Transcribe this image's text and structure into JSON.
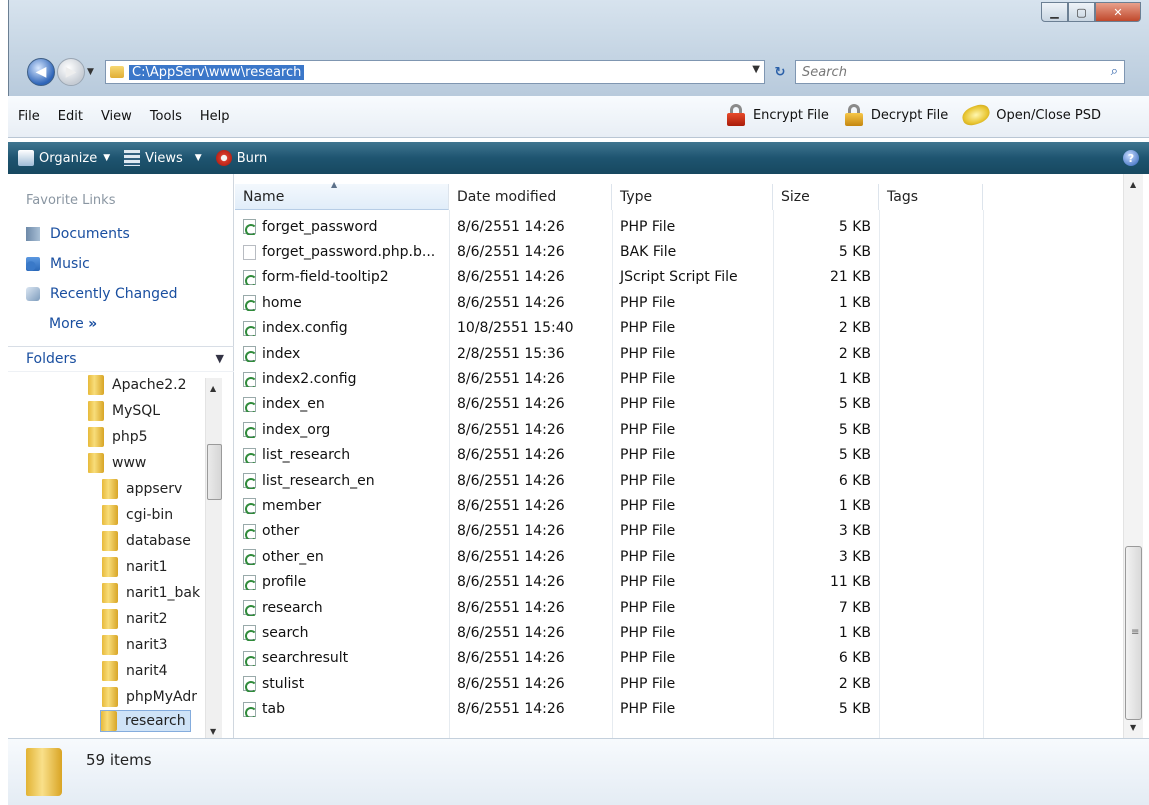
{
  "address": {
    "path": "C:\\AppServ\\www\\research"
  },
  "search": {
    "placeholder": "Search"
  },
  "menu": [
    "File",
    "Edit",
    "View",
    "Tools",
    "Help"
  ],
  "menu_right": {
    "encrypt": "Encrypt File",
    "decrypt": "Decrypt File",
    "psd": "Open/Close PSD"
  },
  "toolbar": {
    "organize": "Organize",
    "views": "Views",
    "burn": "Burn"
  },
  "favorites": {
    "title": "Favorite Links",
    "items": [
      "Documents",
      "Music",
      "Recently Changed"
    ],
    "more": "More"
  },
  "folders": {
    "title": "Folders",
    "tree": [
      "Apache2.2",
      "MySQL",
      "php5",
      "www",
      "appserv",
      "cgi-bin",
      "database",
      "narit1",
      "narit1_bak",
      "narit2",
      "narit3",
      "narit4",
      "phpMyAdr",
      "research"
    ]
  },
  "columns": {
    "name": "Name",
    "date": "Date modified",
    "type": "Type",
    "size": "Size",
    "tags": "Tags"
  },
  "files": [
    {
      "name": "forget_password",
      "date": "8/6/2551 14:26",
      "type": "PHP File",
      "size": "5 KB",
      "icon": "php"
    },
    {
      "name": "forget_password.php.b...",
      "date": "8/6/2551 14:26",
      "type": "BAK File",
      "size": "5 KB",
      "icon": "bak"
    },
    {
      "name": "form-field-tooltip2",
      "date": "8/6/2551 14:26",
      "type": "JScript Script File",
      "size": "21 KB",
      "icon": "js"
    },
    {
      "name": "home",
      "date": "8/6/2551 14:26",
      "type": "PHP File",
      "size": "1 KB",
      "icon": "php"
    },
    {
      "name": "index.config",
      "date": "10/8/2551 15:40",
      "type": "PHP File",
      "size": "2 KB",
      "icon": "php"
    },
    {
      "name": "index",
      "date": "2/8/2551 15:36",
      "type": "PHP File",
      "size": "2 KB",
      "icon": "php"
    },
    {
      "name": "index2.config",
      "date": "8/6/2551 14:26",
      "type": "PHP File",
      "size": "1 KB",
      "icon": "php"
    },
    {
      "name": "index_en",
      "date": "8/6/2551 14:26",
      "type": "PHP File",
      "size": "5 KB",
      "icon": "php"
    },
    {
      "name": "index_org",
      "date": "8/6/2551 14:26",
      "type": "PHP File",
      "size": "5 KB",
      "icon": "php"
    },
    {
      "name": "list_research",
      "date": "8/6/2551 14:26",
      "type": "PHP File",
      "size": "5 KB",
      "icon": "php"
    },
    {
      "name": "list_research_en",
      "date": "8/6/2551 14:26",
      "type": "PHP File",
      "size": "6 KB",
      "icon": "php"
    },
    {
      "name": "member",
      "date": "8/6/2551 14:26",
      "type": "PHP File",
      "size": "1 KB",
      "icon": "php"
    },
    {
      "name": "other",
      "date": "8/6/2551 14:26",
      "type": "PHP File",
      "size": "3 KB",
      "icon": "php"
    },
    {
      "name": "other_en",
      "date": "8/6/2551 14:26",
      "type": "PHP File",
      "size": "3 KB",
      "icon": "php"
    },
    {
      "name": "profile",
      "date": "8/6/2551 14:26",
      "type": "PHP File",
      "size": "11 KB",
      "icon": "php"
    },
    {
      "name": "research",
      "date": "8/6/2551 14:26",
      "type": "PHP File",
      "size": "7 KB",
      "icon": "php"
    },
    {
      "name": "search",
      "date": "8/6/2551 14:26",
      "type": "PHP File",
      "size": "1 KB",
      "icon": "php"
    },
    {
      "name": "searchresult",
      "date": "8/6/2551 14:26",
      "type": "PHP File",
      "size": "6 KB",
      "icon": "php"
    },
    {
      "name": "stulist",
      "date": "8/6/2551 14:26",
      "type": "PHP File",
      "size": "2 KB",
      "icon": "php"
    },
    {
      "name": "tab",
      "date": "8/6/2551 14:26",
      "type": "PHP File",
      "size": "5 KB",
      "icon": "php"
    }
  ],
  "status": {
    "count": "59 items"
  }
}
